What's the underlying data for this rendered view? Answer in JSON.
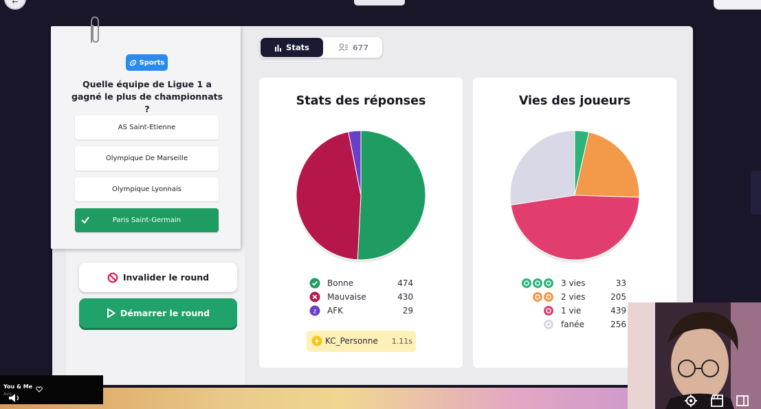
{
  "question": {
    "category": "Sports",
    "text": "Quelle équipe de Ligue 1 a gagné le plus de championnats ?",
    "answers": [
      {
        "label": "AS Saint-Etienne",
        "correct": false
      },
      {
        "label": "Olympique De Marseille",
        "correct": false
      },
      {
        "label": "Olympique Lyonnais",
        "correct": false
      },
      {
        "label": "Paris Saint-Germain",
        "correct": true
      }
    ]
  },
  "actions": {
    "invalidate_label": "Invalider le round",
    "start_label": "Démarrer le round"
  },
  "tabs": {
    "stats_label": "Stats",
    "players_count": "677"
  },
  "answers_stats": {
    "title": "Stats des réponses",
    "legend": [
      {
        "label": "Bonne",
        "value": "474",
        "color": "#1f9c61",
        "icon": "check-circle-icon"
      },
      {
        "label": "Mauvaise",
        "value": "430",
        "color": "#b5174a",
        "icon": "x-circle-icon"
      },
      {
        "label": "AFK",
        "value": "29",
        "color": "#6a3fc8",
        "icon": "afk-icon"
      }
    ],
    "fastest": {
      "name": "KC_Personne",
      "time": "1.11s"
    }
  },
  "lives_stats": {
    "title": "Vies des joueurs",
    "legend": [
      {
        "label": "3 vies",
        "value": "33",
        "color": "#2eb37a",
        "icon": "three-lives-icon"
      },
      {
        "label": "2 vies",
        "value": "205",
        "color": "#f2994a",
        "icon": "two-lives-icon"
      },
      {
        "label": "1 vie",
        "value": "439",
        "color": "#e13d6e",
        "icon": "one-life-icon"
      },
      {
        "label": "fanée",
        "value": "256",
        "color": "#d8d8e6",
        "icon": "faded-icon"
      }
    ]
  },
  "chart_data": [
    {
      "type": "pie",
      "title": "Stats des réponses",
      "categories": [
        "Bonne",
        "Mauvaise",
        "AFK"
      ],
      "values": [
        474,
        430,
        29
      ]
    },
    {
      "type": "pie",
      "title": "Vies des joueurs",
      "categories": [
        "3 vies",
        "2 vies",
        "1 vie",
        "fanée"
      ],
      "values": [
        33,
        205,
        439,
        256
      ]
    }
  ],
  "music": {
    "title": "You & Me",
    "subtitle": "Avis"
  }
}
